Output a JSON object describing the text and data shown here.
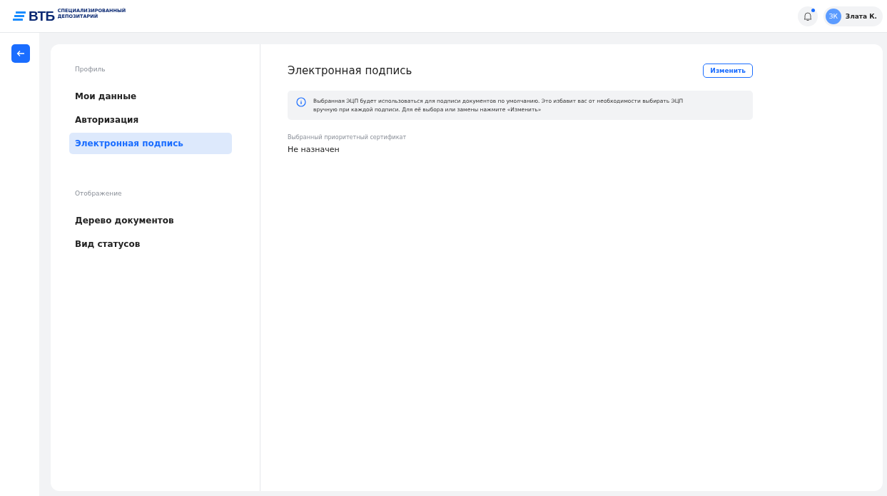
{
  "header": {
    "logo": {
      "wordmark": "ВТБ",
      "subtitle": [
        "СПЕЦИАЛИЗИРОВАННЫЙ",
        "ДЕПОЗИТАРИЙ"
      ]
    },
    "notifications": {
      "unread": true
    },
    "user": {
      "initials": "ЗК",
      "name": "Злата К."
    }
  },
  "sidebar": {
    "sections": [
      {
        "title": "Профиль",
        "items": [
          {
            "label": "Мои данные",
            "selected": false
          },
          {
            "label": "Авторизация",
            "selected": false
          },
          {
            "label": "Электронная подпись",
            "selected": true
          }
        ]
      },
      {
        "title": "Отображение",
        "items": [
          {
            "label": "Дерево документов",
            "selected": false
          },
          {
            "label": "Вид статусов",
            "selected": false
          }
        ]
      }
    ]
  },
  "content": {
    "title": "Электронная подпись",
    "action_button": "Изменить",
    "info": "Выбранная ЭЦП будет использоваться для подписи документов по умолчанию. Это избавит вас от необходимости выбирать ЭЦП вручную при каждой подписи. Для её выбора или замены нажмите «Изменить»",
    "field": {
      "label": "Выбранный приоритетный сертификат",
      "value": "Не назначен"
    }
  }
}
